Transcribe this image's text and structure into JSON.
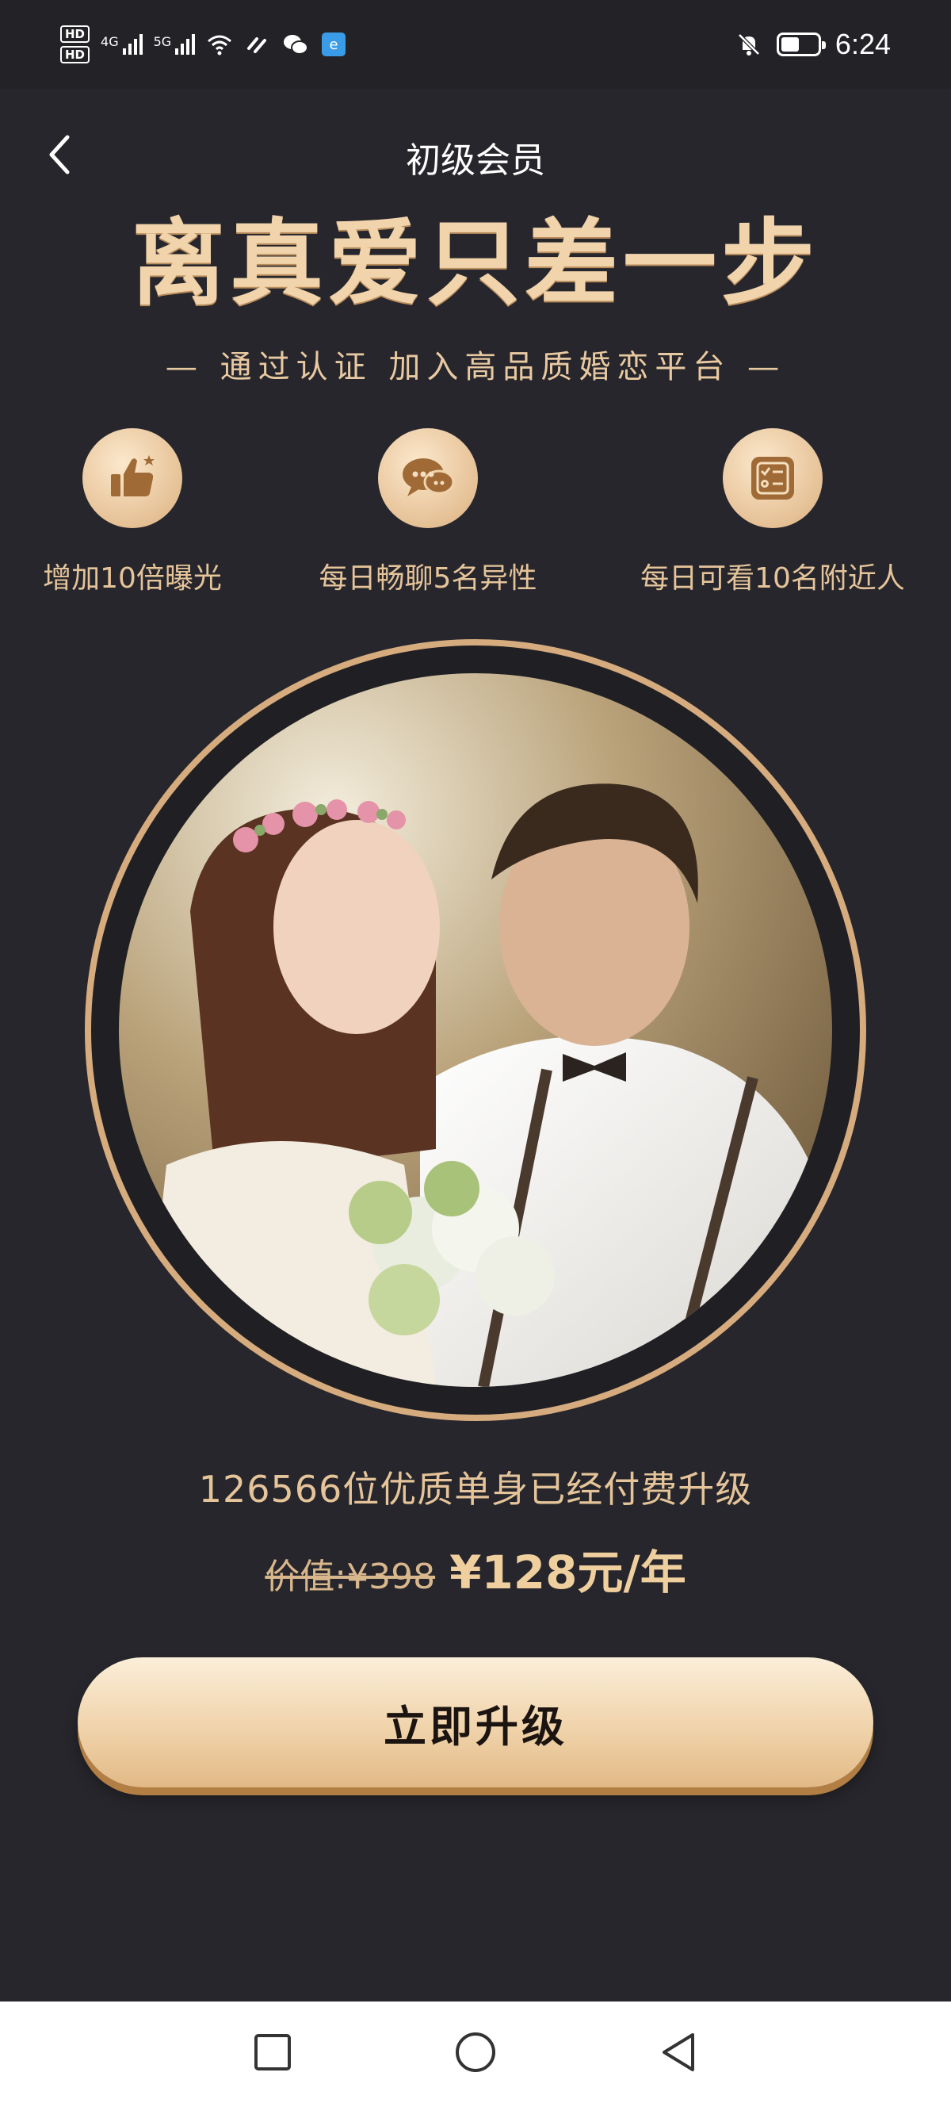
{
  "status_bar": {
    "hd1": "HD",
    "hd2": "HD",
    "net1_label": "4G",
    "net2_label": "5G",
    "time": "6:24",
    "icons": [
      "signal-icon",
      "wifi-icon",
      "link-icon",
      "wechat-icon",
      "app-notification-icon",
      "mute-bell-icon",
      "battery-icon"
    ],
    "battery_level": 0.5
  },
  "header": {
    "title": "初级会员"
  },
  "hero": {
    "headline": "离真爱只差一步",
    "subtitle": "— 通过认证 加入高品质婚恋平台 —"
  },
  "benefits": [
    {
      "icon": "thumbs-up-icon",
      "label": "增加10倍曝光"
    },
    {
      "icon": "chat-bubbles-icon",
      "label": "每日畅聊5名异性"
    },
    {
      "icon": "checklist-icon",
      "label": "每日可看10名附近人"
    }
  ],
  "offer": {
    "stats": "126566位优质单身已经付费升级",
    "old_price": "价值:¥398",
    "new_price": "¥128元/年"
  },
  "cta": {
    "label": "立即升级"
  },
  "colors": {
    "background": "#26262c",
    "gold": "#e7c9a0",
    "ring": "#d6ab7d"
  }
}
